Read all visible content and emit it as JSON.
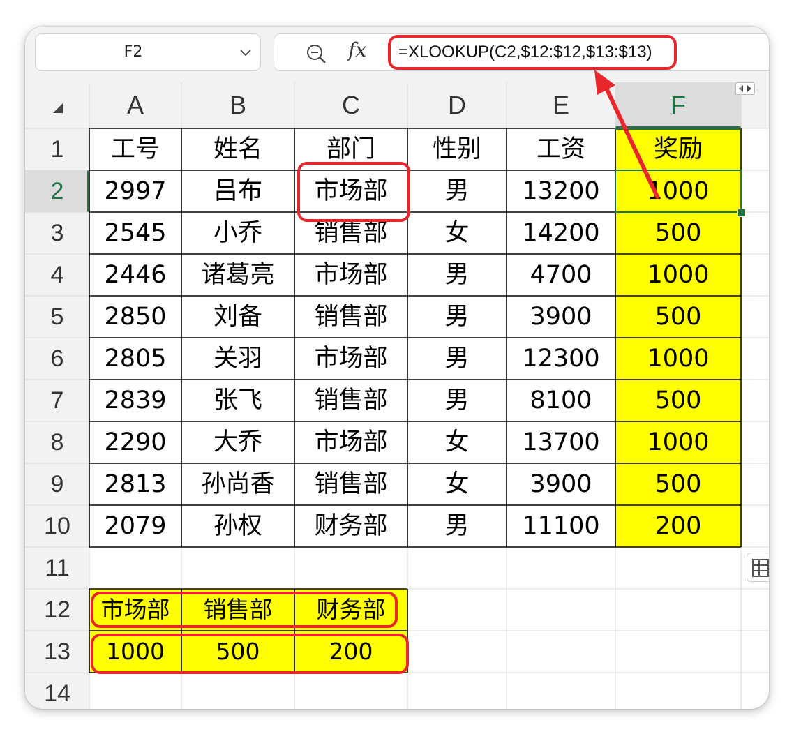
{
  "name_box": {
    "value": "F2"
  },
  "formula_bar": {
    "fx_label": "fx",
    "formula": "=XLOOKUP(C2,$12:$12,$13:$13)"
  },
  "columns": [
    "A",
    "B",
    "C",
    "D",
    "E",
    "F"
  ],
  "selected": {
    "column": "F",
    "row": 2
  },
  "rows": [
    [
      "工号",
      "姓名",
      "部门",
      "性别",
      "工资",
      "奖励"
    ],
    [
      "2997",
      "吕布",
      "市场部",
      "男",
      "13200",
      "1000"
    ],
    [
      "2545",
      "小乔",
      "销售部",
      "女",
      "14200",
      "500"
    ],
    [
      "2446",
      "诸葛亮",
      "市场部",
      "男",
      "4700",
      "1000"
    ],
    [
      "2850",
      "刘备",
      "销售部",
      "男",
      "3900",
      "500"
    ],
    [
      "2805",
      "关羽",
      "市场部",
      "男",
      "12300",
      "1000"
    ],
    [
      "2839",
      "张飞",
      "销售部",
      "男",
      "8100",
      "500"
    ],
    [
      "2290",
      "大乔",
      "市场部",
      "女",
      "13700",
      "1000"
    ],
    [
      "2813",
      "孙尚香",
      "销售部",
      "女",
      "3900",
      "500"
    ],
    [
      "2079",
      "孙权",
      "财务部",
      "男",
      "11100",
      "200"
    ],
    [
      "",
      "",
      "",
      "",
      "",
      ""
    ],
    [
      "市场部",
      "销售部",
      "财务部",
      "",
      "",
      ""
    ],
    [
      "1000",
      "500",
      "200",
      "",
      "",
      ""
    ],
    [
      "",
      "",
      "",
      "",
      "",
      ""
    ]
  ],
  "colors": {
    "highlight": "#ffff00",
    "annotation": "#e8262b",
    "selection": "#217346"
  }
}
